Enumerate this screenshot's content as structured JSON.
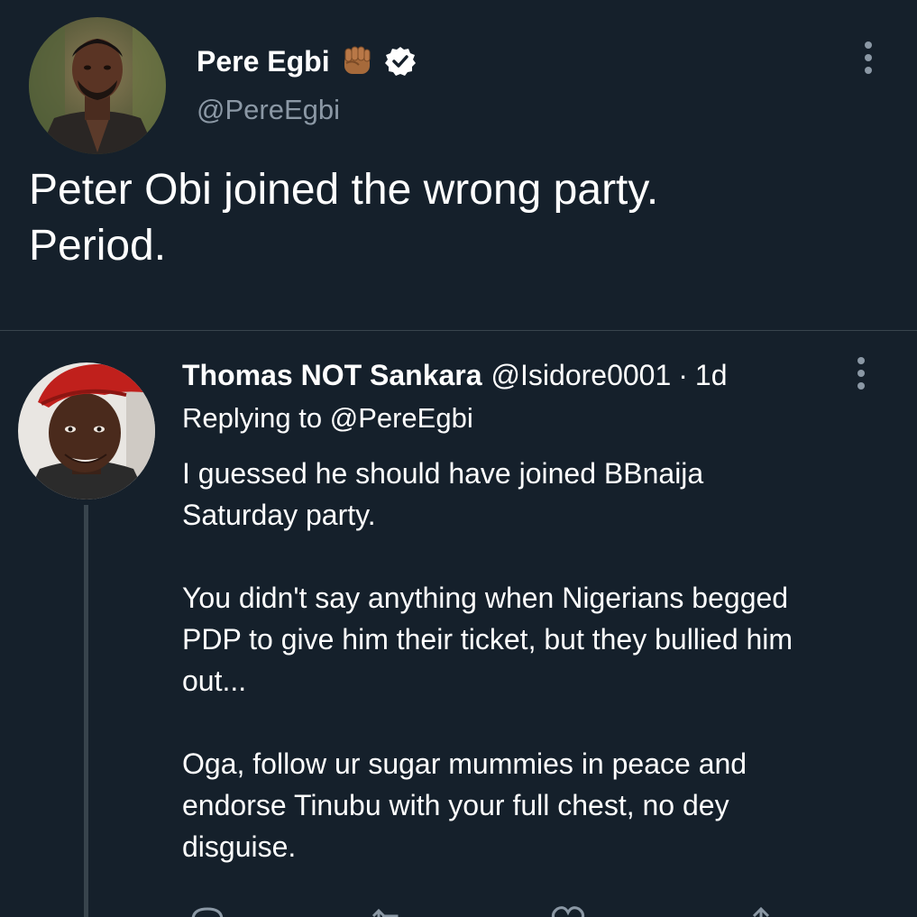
{
  "main_tweet": {
    "author_name": "Pere Egbi",
    "author_handle": "@PereEgbi",
    "text": "Peter Obi joined the wrong party.\nPeriod.",
    "avatar_icon": "profile-photo",
    "badges": [
      "raised-fist-emoji",
      "verified-badge"
    ]
  },
  "reply": {
    "author_name": "Thomas NOT Sankara",
    "author_handle": "@Isidore0001",
    "separator": "·",
    "time": "1d",
    "replying_to_prefix": "Replying to ",
    "replying_to_handle": "@PereEgbi",
    "paragraphs": [
      "I guessed he should have joined BBnaija\nSaturday party.",
      "You didn't say anything when Nigerians begged\nPDP to give him their ticket, but they bullied him\nout...",
      "Oga, follow ur sugar mummies in peace and\nendorse Tinubu with your full chest, no dey\ndisguise."
    ],
    "avatar_icon": "profile-photo"
  },
  "colors": {
    "background": "#15202b",
    "text": "#ffffff",
    "secondary_text": "#8b98a5",
    "divider": "#38444d",
    "verified_badge": "#ffffff"
  }
}
